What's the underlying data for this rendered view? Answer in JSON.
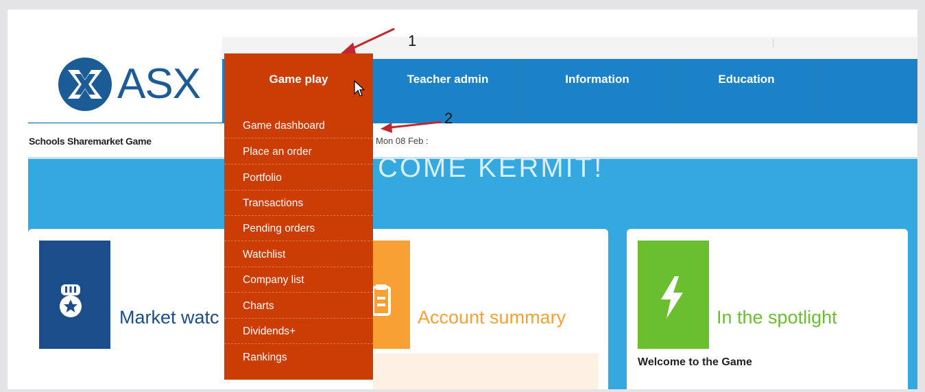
{
  "logo": {
    "text": "ASX"
  },
  "nav": {
    "game_play": "Game play",
    "teacher_admin": "Teacher admin",
    "information": "Information",
    "education": "Education"
  },
  "subbar": {
    "title": "Schools Sharemarket Game",
    "date": "Mon 08 Feb :"
  },
  "welcome": "COME KERMIT!",
  "menu": {
    "items": [
      {
        "label": "Game dashboard"
      },
      {
        "label": "Place an order"
      },
      {
        "label": "Portfolio"
      },
      {
        "label": "Transactions"
      },
      {
        "label": "Pending orders"
      },
      {
        "label": "Watchlist"
      },
      {
        "label": "Company list"
      },
      {
        "label": "Charts"
      },
      {
        "label": "Dividends+"
      },
      {
        "label": "Rankings"
      }
    ]
  },
  "cards": {
    "market_watch": {
      "title": "Market watc",
      "icon": "medal-icon",
      "color": "#1a4d8a"
    },
    "account_summary": {
      "title": "Account summary",
      "icon": "clipboard-icon",
      "color": "#f7a033"
    },
    "spotlight": {
      "title": "In the spotlight",
      "subtitle": "Welcome to the Game",
      "icon": "lightning-icon",
      "color": "#6abf2e"
    }
  },
  "annotations": {
    "one": "1",
    "two": "2"
  },
  "colors": {
    "nav_blue": "#1b82c8",
    "menu_orange": "#cc3d05",
    "hero_blue": "#34a9e0",
    "arrow_red": "#c0282d"
  }
}
